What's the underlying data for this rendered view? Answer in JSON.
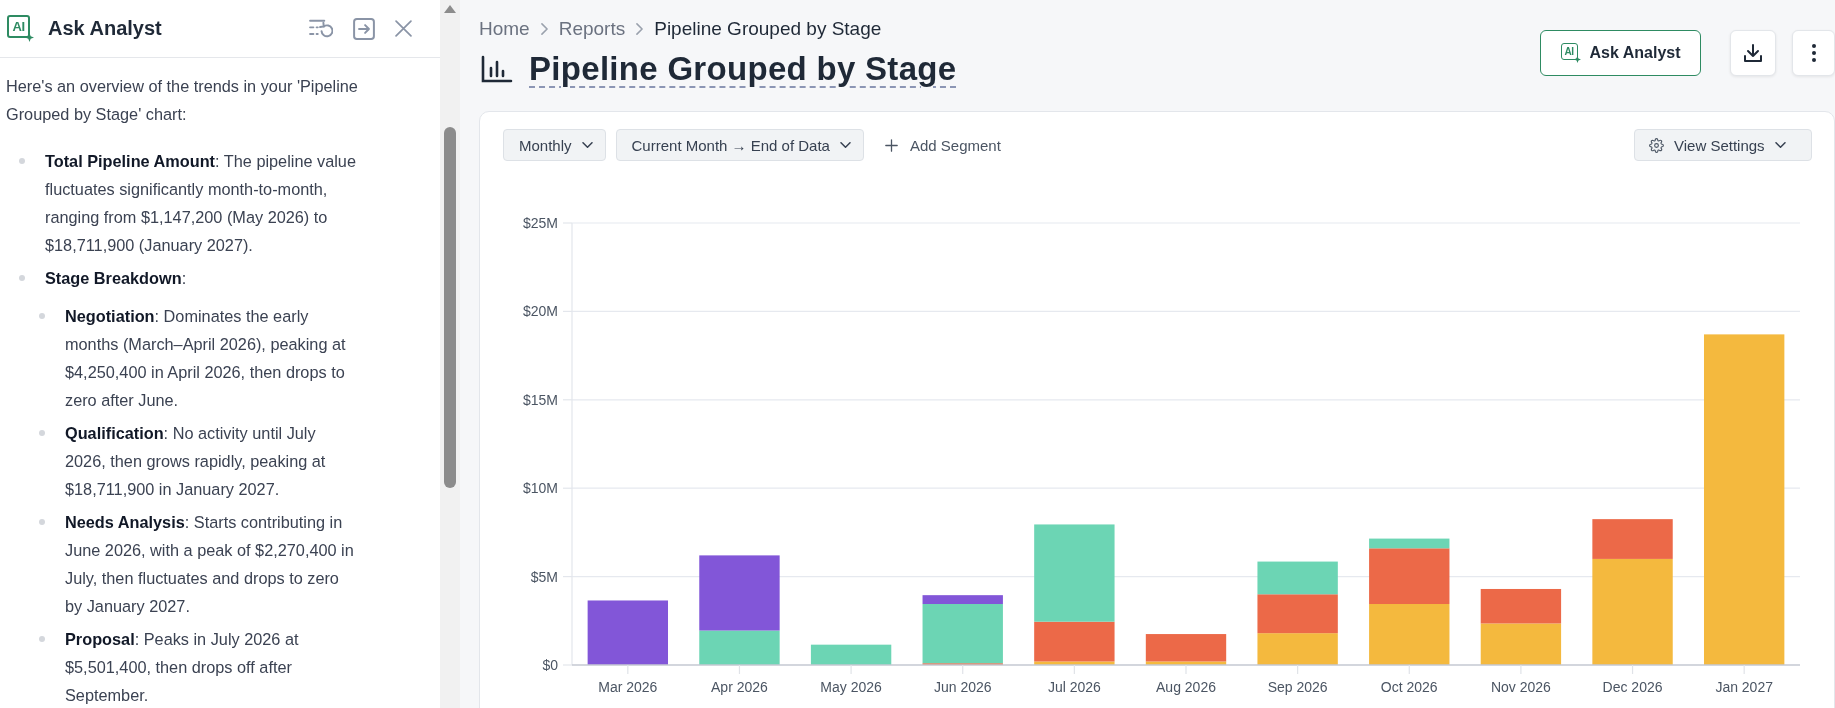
{
  "panel": {
    "logo_text": "AI",
    "title": "Ask Analyst",
    "intro": "Here's an overview of the trends in your 'Pipeline Grouped by Stage' chart:",
    "items": [
      {
        "text": "**Total Pipeline Amount**: The pipeline value fluctuates significantly month-to-month, ranging from $1,147,200 (May 2026) to $18,711,900 (January 2027)."
      },
      {
        "text": "**Stage Breakdown**:",
        "children": [
          {
            "text": "**Negotiation**: Dominates the early months (March–April 2026), peaking at $4,250,400 in April 2026, then drops to zero after June."
          },
          {
            "text": "**Qualification**: No activity until July 2026, then grows rapidly, peaking at $18,711,900 in January 2027."
          },
          {
            "text": "**Needs Analysis**: Starts contributing in June 2026, with a peak of $2,270,400 in July, then fluctuates and drops to zero by January 2027."
          },
          {
            "text": "**Proposal**: Peaks in July 2026 at $5,501,400, then drops off after September."
          }
        ]
      }
    ]
  },
  "breadcrumb": [
    {
      "label": "Home",
      "current": false
    },
    {
      "label": "Reports",
      "current": false
    },
    {
      "label": "Pipeline Grouped by Stage",
      "current": true
    }
  ],
  "title": "Pipeline Grouped by Stage",
  "ask_button": {
    "logo_text": "AI",
    "label": "Ask Analyst"
  },
  "toolbar": {
    "filters": [
      {
        "label": "Monthly"
      },
      {
        "label": "Current Month → End of Data"
      }
    ],
    "add_segment": "Add Segment",
    "view_settings": "View Settings"
  },
  "chart": {
    "chart_data": {
      "type": "bar",
      "stacked": true,
      "grid": true,
      "categories": [
        "Mar 2026",
        "Apr 2026",
        "May 2026",
        "Jun 2026",
        "Jul 2026",
        "Aug 2026",
        "Sep 2026",
        "Oct 2026",
        "Nov 2026",
        "Dec 2026",
        "Jan 2027"
      ],
      "series": [
        {
          "color": "#f4b93e",
          "values": [
            null,
            null,
            null,
            null,
            200000,
            200000,
            1800000,
            3450000,
            2350000,
            6000000,
            18700000
          ]
        },
        {
          "color": "#ec6948",
          "values": [
            null,
            null,
            null,
            100000,
            2250000,
            1550000,
            2200000,
            3150000,
            1950000,
            2250000,
            null
          ]
        },
        {
          "color": "#6cd5b4",
          "values": [
            null,
            1950000,
            1150000,
            3350000,
            5500000,
            null,
            1850000,
            550000,
            null,
            null,
            null
          ]
        },
        {
          "color": "#8256d8",
          "values": [
            3650000,
            4250000,
            null,
            500000,
            null,
            null,
            null,
            null,
            null,
            null,
            null
          ]
        }
      ],
      "ylim": [
        0,
        25000000
      ],
      "yticks": [
        {
          "value": 0,
          "label": "$0"
        },
        {
          "value": 5000000,
          "label": "$5M"
        },
        {
          "value": 10000000,
          "label": "$10M"
        },
        {
          "value": 15000000,
          "label": "$15M"
        },
        {
          "value": 20000000,
          "label": "$20M"
        },
        {
          "value": 25000000,
          "label": "$25M"
        }
      ]
    }
  }
}
